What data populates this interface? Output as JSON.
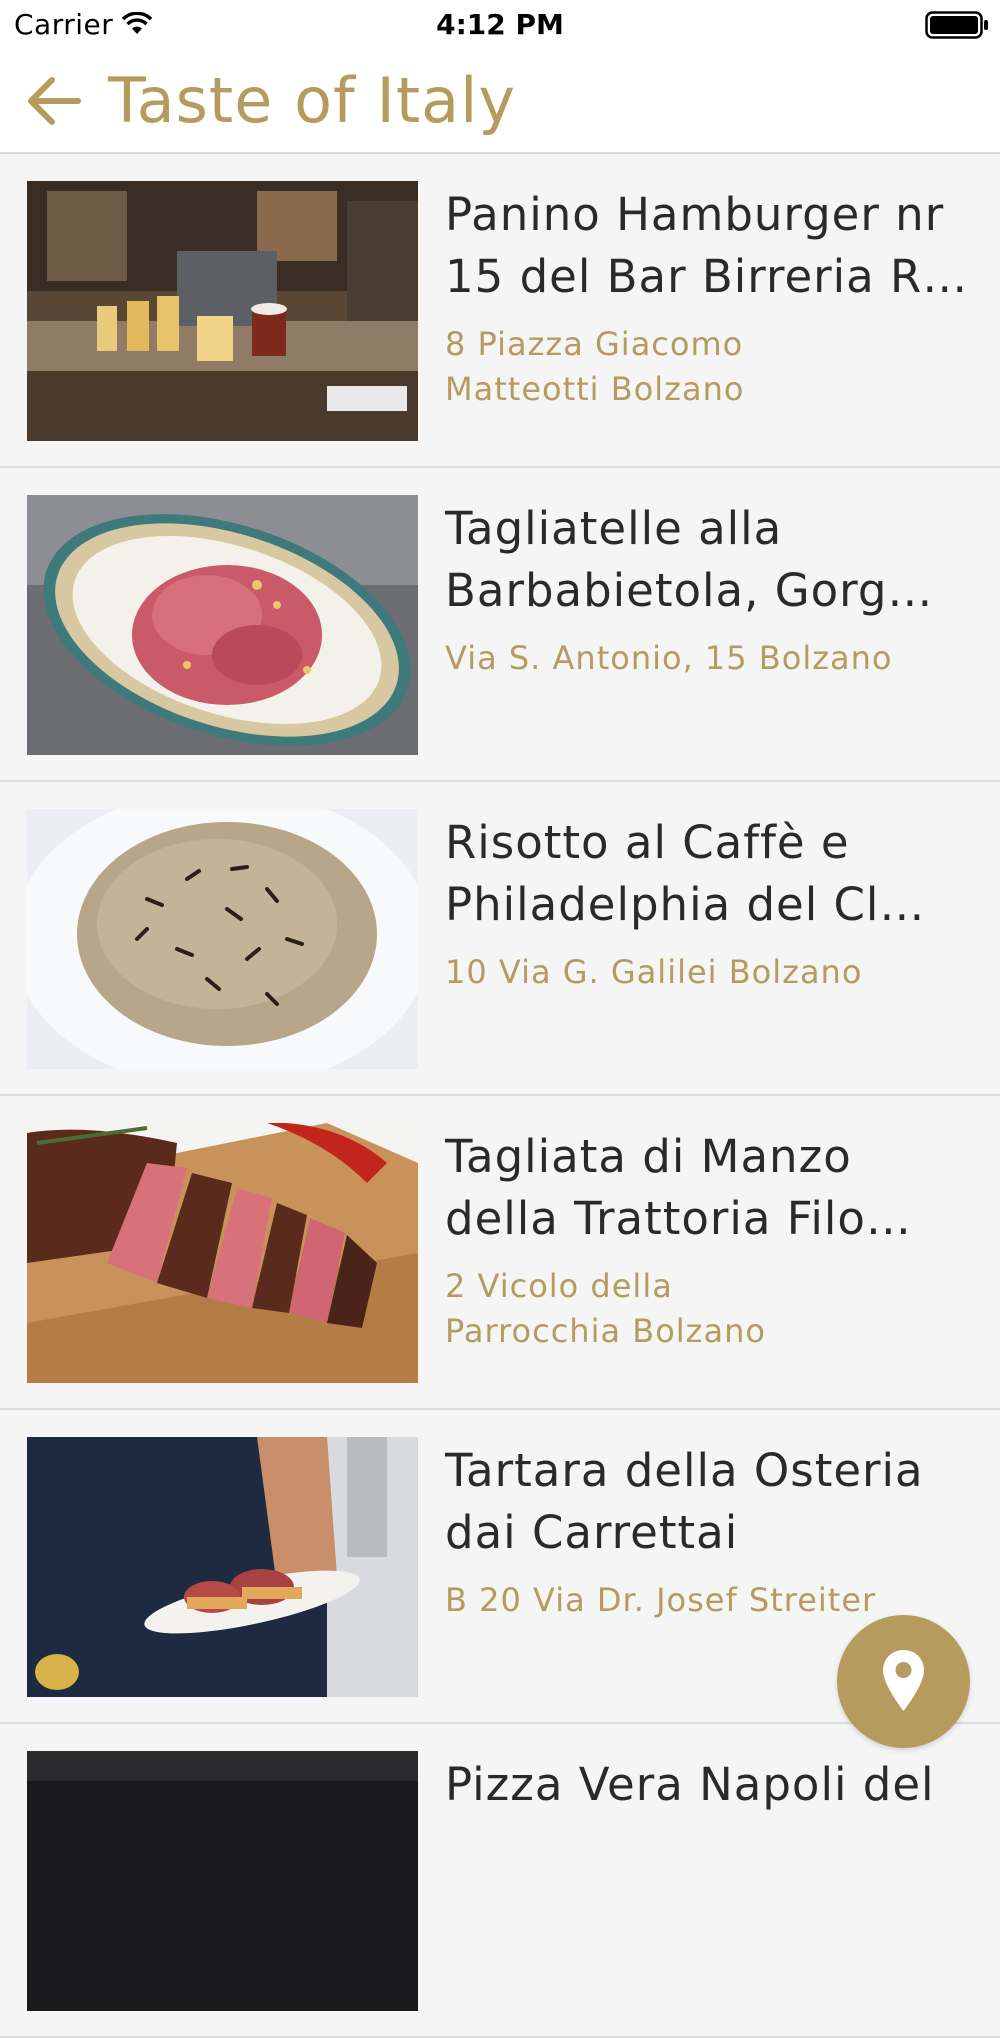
{
  "status_bar": {
    "carrier": "Carrier",
    "time": "4:12 PM",
    "icons": [
      "wifi-icon",
      "battery-icon"
    ]
  },
  "nav": {
    "title": "Taste of Italy",
    "back_icon": "arrow-left-icon"
  },
  "colors": {
    "accent": "#b69b5f",
    "background": "#f5f5f6",
    "title_text": "#2a2a2c"
  },
  "items": [
    {
      "title": "Panino Hamburger nr 15 del Bar Birreria R…",
      "address": "8 Piazza Giacomo Matteotti Bolzano",
      "image": "bar-counter-with-beers-photo"
    },
    {
      "title": "Tagliatelle alla Barbabietola, Gorg…",
      "address": "Via S. Antonio, 15 Bolzano",
      "image": "pink-tagliatelle-plate-photo"
    },
    {
      "title": "Risotto al Caffè e Philadelphia del Cl…",
      "address": "10 Via G. Galilei Bolzano",
      "image": "coffee-risotto-plate-photo"
    },
    {
      "title": "Tagliata di Manzo della Trattoria Filo…",
      "address": "2 Vicolo della Parrocchia Bolzano",
      "image": "sliced-beef-board-photo"
    },
    {
      "title": "Tartara della Osteria dai Carrettai",
      "address": "B 20 Via Dr. Josef Streiter",
      "image": "tartare-plate-held-photo"
    },
    {
      "title": "Pizza Vera Napoli del",
      "address": "",
      "image": "pizza-photo"
    }
  ],
  "fab": {
    "icon": "map-pin-icon"
  }
}
